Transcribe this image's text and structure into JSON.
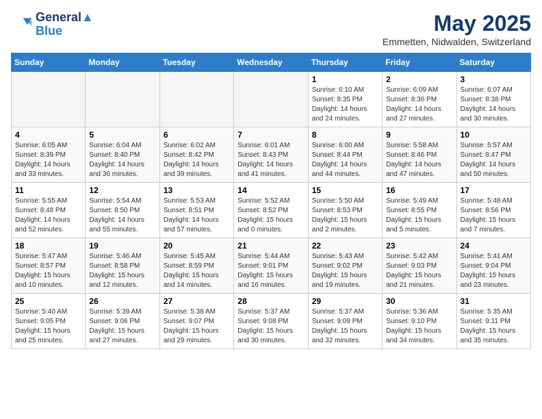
{
  "header": {
    "logo_line1": "General",
    "logo_line2": "Blue",
    "month": "May 2025",
    "location": "Emmetten, Nidwalden, Switzerland"
  },
  "weekdays": [
    "Sunday",
    "Monday",
    "Tuesday",
    "Wednesday",
    "Thursday",
    "Friday",
    "Saturday"
  ],
  "weeks": [
    [
      {
        "day": "",
        "empty": true
      },
      {
        "day": "",
        "empty": true
      },
      {
        "day": "",
        "empty": true
      },
      {
        "day": "",
        "empty": true
      },
      {
        "day": "1",
        "sunrise": "6:10 AM",
        "sunset": "8:35 PM",
        "daylight": "14 hours and 24 minutes."
      },
      {
        "day": "2",
        "sunrise": "6:09 AM",
        "sunset": "8:36 PM",
        "daylight": "14 hours and 27 minutes."
      },
      {
        "day": "3",
        "sunrise": "6:07 AM",
        "sunset": "8:38 PM",
        "daylight": "14 hours and 30 minutes."
      }
    ],
    [
      {
        "day": "4",
        "sunrise": "6:05 AM",
        "sunset": "8:39 PM",
        "daylight": "14 hours and 33 minutes."
      },
      {
        "day": "5",
        "sunrise": "6:04 AM",
        "sunset": "8:40 PM",
        "daylight": "14 hours and 36 minutes."
      },
      {
        "day": "6",
        "sunrise": "6:02 AM",
        "sunset": "8:42 PM",
        "daylight": "14 hours and 39 minutes."
      },
      {
        "day": "7",
        "sunrise": "6:01 AM",
        "sunset": "8:43 PM",
        "daylight": "14 hours and 41 minutes."
      },
      {
        "day": "8",
        "sunrise": "6:00 AM",
        "sunset": "8:44 PM",
        "daylight": "14 hours and 44 minutes."
      },
      {
        "day": "9",
        "sunrise": "5:58 AM",
        "sunset": "8:46 PM",
        "daylight": "14 hours and 47 minutes."
      },
      {
        "day": "10",
        "sunrise": "5:57 AM",
        "sunset": "8:47 PM",
        "daylight": "14 hours and 50 minutes."
      }
    ],
    [
      {
        "day": "11",
        "sunrise": "5:55 AM",
        "sunset": "8:48 PM",
        "daylight": "14 hours and 52 minutes."
      },
      {
        "day": "12",
        "sunrise": "5:54 AM",
        "sunset": "8:50 PM",
        "daylight": "14 hours and 55 minutes."
      },
      {
        "day": "13",
        "sunrise": "5:53 AM",
        "sunset": "8:51 PM",
        "daylight": "14 hours and 57 minutes."
      },
      {
        "day": "14",
        "sunrise": "5:52 AM",
        "sunset": "8:52 PM",
        "daylight": "15 hours and 0 minutes."
      },
      {
        "day": "15",
        "sunrise": "5:50 AM",
        "sunset": "8:53 PM",
        "daylight": "15 hours and 2 minutes."
      },
      {
        "day": "16",
        "sunrise": "5:49 AM",
        "sunset": "8:55 PM",
        "daylight": "15 hours and 5 minutes."
      },
      {
        "day": "17",
        "sunrise": "5:48 AM",
        "sunset": "8:56 PM",
        "daylight": "15 hours and 7 minutes."
      }
    ],
    [
      {
        "day": "18",
        "sunrise": "5:47 AM",
        "sunset": "8:57 PM",
        "daylight": "15 hours and 10 minutes."
      },
      {
        "day": "19",
        "sunrise": "5:46 AM",
        "sunset": "8:58 PM",
        "daylight": "15 hours and 12 minutes."
      },
      {
        "day": "20",
        "sunrise": "5:45 AM",
        "sunset": "8:59 PM",
        "daylight": "15 hours and 14 minutes."
      },
      {
        "day": "21",
        "sunrise": "5:44 AM",
        "sunset": "9:01 PM",
        "daylight": "15 hours and 16 minutes."
      },
      {
        "day": "22",
        "sunrise": "5:43 AM",
        "sunset": "9:02 PM",
        "daylight": "15 hours and 19 minutes."
      },
      {
        "day": "23",
        "sunrise": "5:42 AM",
        "sunset": "9:03 PM",
        "daylight": "15 hours and 21 minutes."
      },
      {
        "day": "24",
        "sunrise": "5:41 AM",
        "sunset": "9:04 PM",
        "daylight": "15 hours and 23 minutes."
      }
    ],
    [
      {
        "day": "25",
        "sunrise": "5:40 AM",
        "sunset": "9:05 PM",
        "daylight": "15 hours and 25 minutes."
      },
      {
        "day": "26",
        "sunrise": "5:39 AM",
        "sunset": "9:06 PM",
        "daylight": "15 hours and 27 minutes."
      },
      {
        "day": "27",
        "sunrise": "5:38 AM",
        "sunset": "9:07 PM",
        "daylight": "15 hours and 29 minutes."
      },
      {
        "day": "28",
        "sunrise": "5:37 AM",
        "sunset": "9:08 PM",
        "daylight": "15 hours and 30 minutes."
      },
      {
        "day": "29",
        "sunrise": "5:37 AM",
        "sunset": "9:09 PM",
        "daylight": "15 hours and 32 minutes."
      },
      {
        "day": "30",
        "sunrise": "5:36 AM",
        "sunset": "9:10 PM",
        "daylight": "15 hours and 34 minutes."
      },
      {
        "day": "31",
        "sunrise": "5:35 AM",
        "sunset": "9:11 PM",
        "daylight": "15 hours and 35 minutes."
      }
    ]
  ]
}
